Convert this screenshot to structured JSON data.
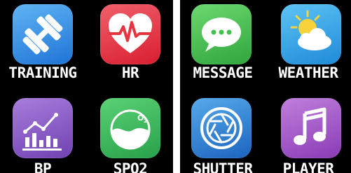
{
  "screens": [
    {
      "apps": [
        {
          "label": "TRAINING",
          "icon": "dumbbell-icon",
          "color": "#2f8fe6"
        },
        {
          "label": "HR",
          "icon": "heart-rate-icon",
          "color": "#e8343f"
        },
        {
          "label": "BP",
          "icon": "blood-pressure-chart-icon",
          "color": "#8e5bc6"
        },
        {
          "label": "SPO2",
          "icon": "oxygen-icon",
          "color": "#3bb85a"
        }
      ]
    },
    {
      "apps": [
        {
          "label": "MESSAGE",
          "icon": "message-icon",
          "color": "#44c04e"
        },
        {
          "label": "WEATHER",
          "icon": "weather-icon",
          "color": "#2ea9ea"
        },
        {
          "label": "SHUTTER",
          "icon": "camera-shutter-icon",
          "color": "#2f86d6"
        },
        {
          "label": "PLAYER",
          "icon": "music-note-icon",
          "color": "#a552c7"
        }
      ]
    }
  ]
}
